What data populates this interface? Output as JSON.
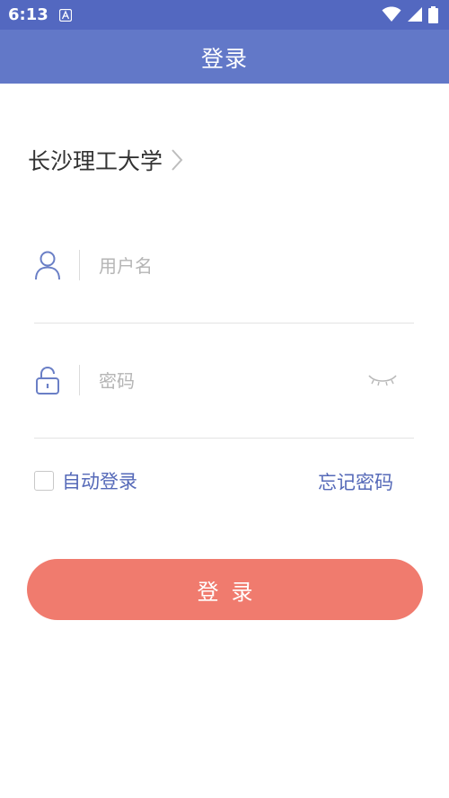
{
  "status_bar": {
    "time": "6:13",
    "color": "#5368c0"
  },
  "app_bar": {
    "title": "登录",
    "color": "#6278c8"
  },
  "school": {
    "name": "长沙理工大学"
  },
  "username_field": {
    "value": "",
    "placeholder": "用户名",
    "icon": "user-icon"
  },
  "password_field": {
    "value": "",
    "placeholder": "密码",
    "icon": "lock-icon",
    "toggle_icon": "eye-closed-icon"
  },
  "options": {
    "auto_login_label": "自动登录",
    "auto_login_checked": false,
    "forgot_password_label": "忘记密码",
    "link_color": "#5569b8"
  },
  "login_button": {
    "label": "登录",
    "color": "#f07b6e"
  }
}
